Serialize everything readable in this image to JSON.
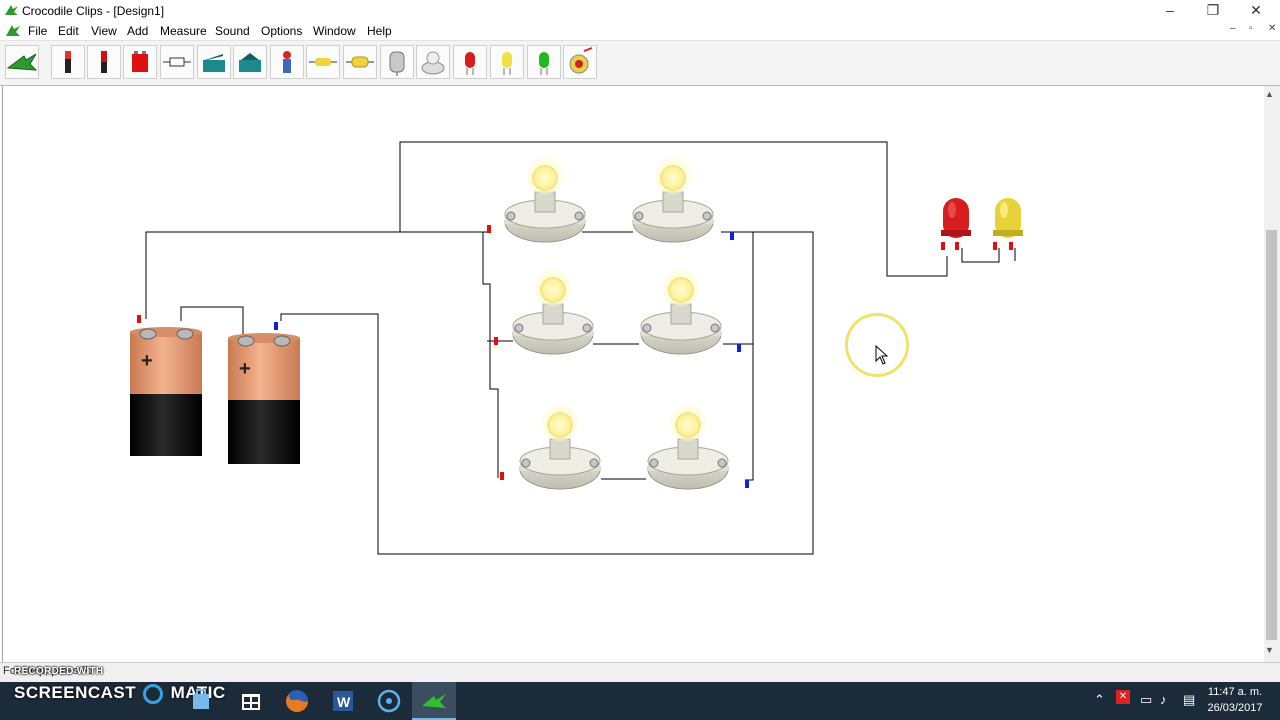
{
  "window": {
    "title": "Crocodile Clips - [Design1]",
    "minimize": "–",
    "restore": "❐",
    "close": "✕",
    "mdi_minimize": "–",
    "mdi_restore": "▫",
    "mdi_close": "✕"
  },
  "menu": [
    "File",
    "Edit",
    "View",
    "Add",
    "Measure",
    "Sound",
    "Options",
    "Window",
    "Help"
  ],
  "toolbar": {
    "tools": [
      "crocodile-icon",
      "cell-icon",
      "battery-icon",
      "battery-pack-icon",
      "fuse-icon",
      "switch-icon",
      "switch-two-way-icon",
      "push-switch-icon",
      "resistor-icon",
      "variable-resistor-icon",
      "motor-icon",
      "bulb-icon",
      "red-led-icon",
      "yellow-led-icon",
      "green-led-icon",
      "buzzer-icon"
    ]
  },
  "colors": {
    "battery_top": "#e9a582",
    "battery_body": "#141414",
    "bulb_glass": "#fff7b0",
    "bulb_base": "#deddd0",
    "red_led": "#d81d1d",
    "yellow_led": "#e7d23a",
    "terminal_red": "#e01010",
    "terminal_blue": "#1020e0",
    "taskbar": "#1c2b3a"
  },
  "circuit": {
    "battery_sign_1": "+",
    "battery_sign_2": "+"
  },
  "status": {
    "text": "For Help, press F1"
  },
  "watermark": {
    "top": "RECORDED WITH",
    "main": "SCREENCAST",
    "suffix": "MATIC"
  },
  "taskbar": {
    "apps": [
      "windows-start-icon",
      "search-icon",
      "task-view-icon",
      "file-explorer-icon",
      "store-icon",
      "firefox-icon",
      "word-icon",
      "screencast-icon",
      "crocodile-clips-icon"
    ],
    "time": "11:47 a. m.",
    "date": "26/03/2017"
  }
}
